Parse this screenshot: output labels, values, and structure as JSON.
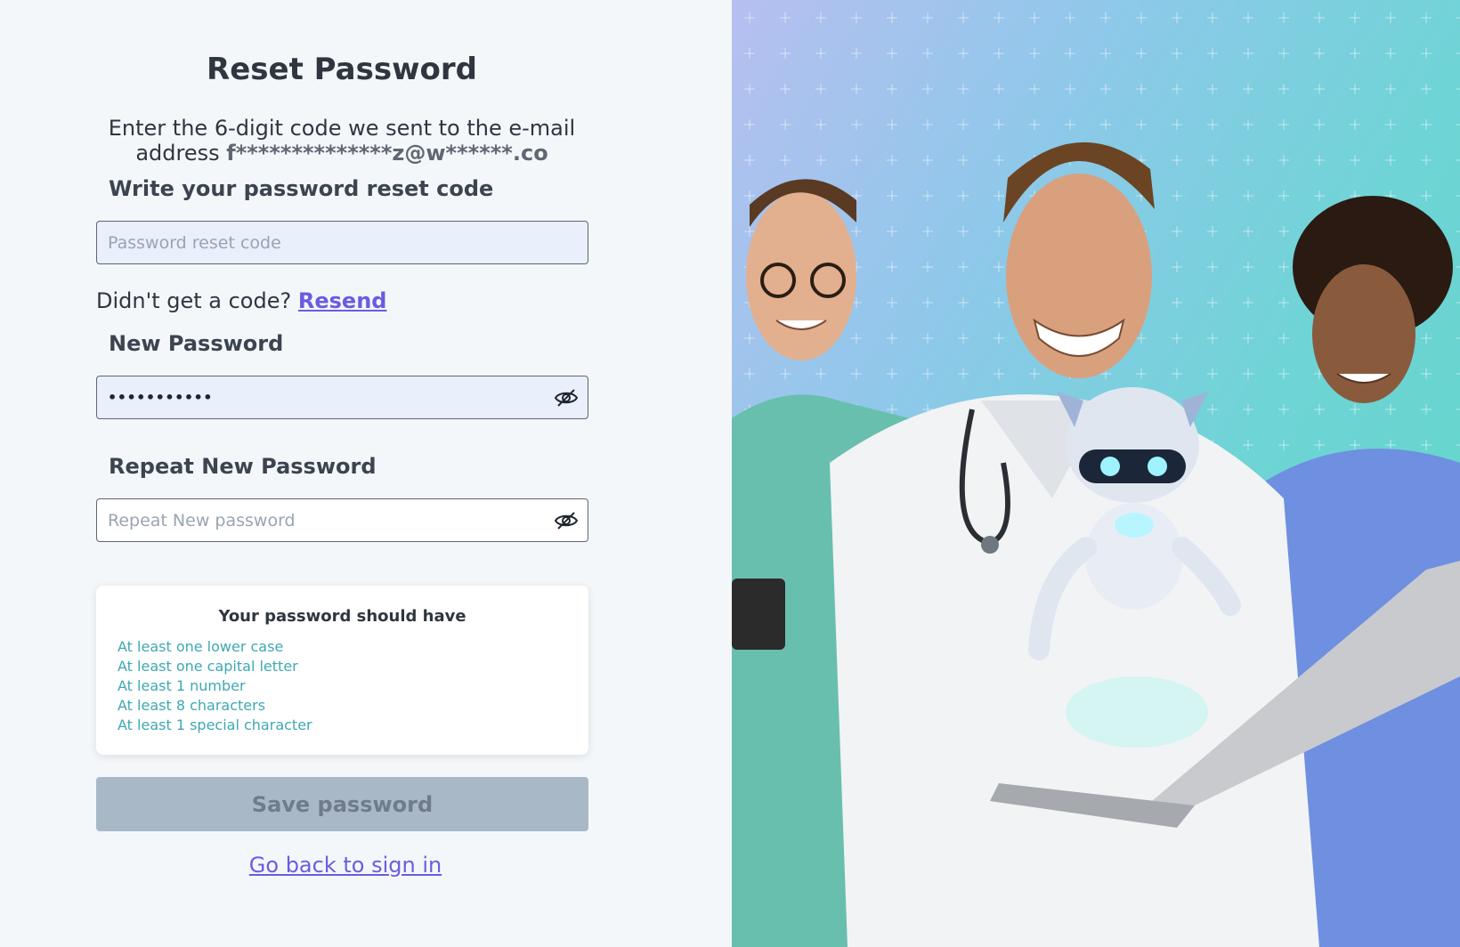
{
  "form": {
    "title": "Reset Password",
    "instruction_prefix": "Enter the 6-digit code we sent to the e-mail address",
    "masked_email": "f**************z@w******.co",
    "code_label": "Write your password reset code",
    "code_placeholder": "Password reset code",
    "resend_prompt": "Didn't get a code?",
    "resend_link": "Resend",
    "new_password_label": "New Password",
    "new_password_value": "•••••••••••",
    "repeat_password_label": "Repeat New Password",
    "repeat_password_placeholder": "Repeat New password",
    "save_button": "Save password",
    "back_link": "Go back to sign in"
  },
  "rules": {
    "title": "Your password should have",
    "items": [
      "At least one lower case",
      "At least one capital letter",
      "At least 1 number",
      "At least 8 characters",
      "At least 1 special character"
    ]
  },
  "icons": {
    "password_toggle": "eye-slash-icon"
  },
  "colors": {
    "link": "#6a5ce0",
    "rule_text": "#3fa8b3",
    "disabled_button": "#a9b8c7",
    "input_fill": "#e9effb"
  }
}
